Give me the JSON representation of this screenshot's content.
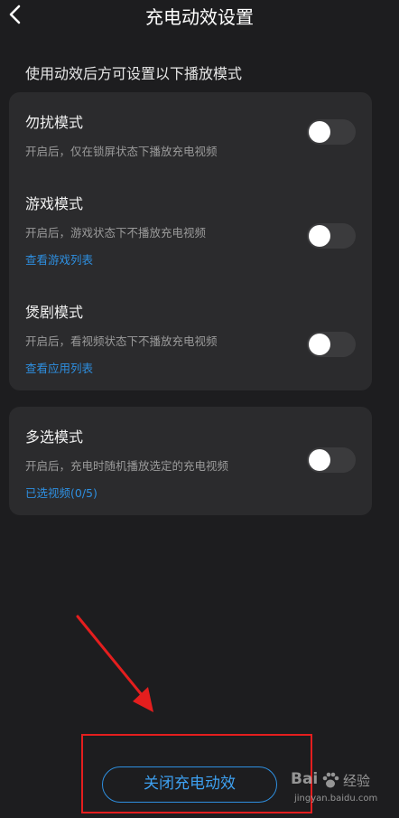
{
  "header": {
    "title": "充电动效设置"
  },
  "hint": "使用动效后方可设置以下播放模式",
  "modes": [
    {
      "title": "勿扰模式",
      "desc": "开启后，仅在锁屏状态下播放充电视频",
      "enabled": false
    },
    {
      "title": "游戏模式",
      "desc": "开启后，游戏状态下不播放充电视频",
      "link": "查看游戏列表",
      "enabled": false
    },
    {
      "title": "煲剧模式",
      "desc": "开启后，看视频状态下不播放充电视频",
      "link": "查看应用列表",
      "enabled": false
    },
    {
      "title": "多选模式",
      "desc": "开启后，充电时随机播放选定的充电视频",
      "link": "已选视频(0/5)",
      "enabled": false
    }
  ],
  "footer": {
    "close_label": "关闭充电动效"
  },
  "watermark": {
    "logo_a": "Bai",
    "logo_b": "经验",
    "url": "jingyan.baidu.com"
  },
  "colors": {
    "accent": "#2e8fe0",
    "annotation": "#e41e1e",
    "background": "#1d1d1f",
    "card": "#2b2b2d"
  },
  "icons": {
    "back": "chevron-left-icon",
    "watermark": "baidu-paw-icon"
  }
}
